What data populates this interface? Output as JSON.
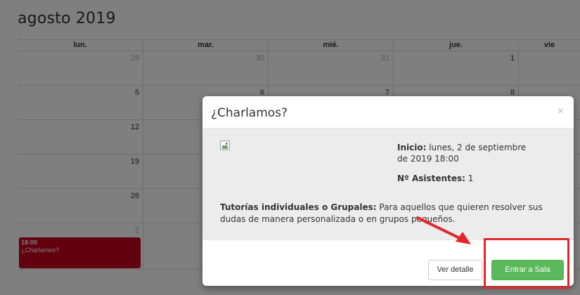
{
  "calendar": {
    "month_title": "agosto 2019",
    "weekdays": [
      "lun.",
      "mar.",
      "mié.",
      "jue.",
      "vie"
    ],
    "weeks": [
      [
        "29",
        "30",
        "31",
        "1",
        ""
      ],
      [
        "5",
        "6",
        "7",
        "8",
        ""
      ],
      [
        "12",
        "",
        "",
        "",
        ""
      ],
      [
        "19",
        "",
        "",
        "",
        ""
      ],
      [
        "26",
        "",
        "",
        "",
        ""
      ],
      [
        "2",
        "",
        "",
        "",
        ""
      ]
    ],
    "event": {
      "time": "18:00",
      "title": "¿Charlamos?",
      "color": "#c4001a"
    }
  },
  "modal": {
    "title": "¿Charlamos?",
    "close_glyph": "×",
    "start_label": "Inicio:",
    "start_value": " lunes, 2 de septiembre de 2019 18:00",
    "attendees_label": "Nº Asistentes:",
    "attendees_value": " 1",
    "desc_label": "Tutorías individuales o Grupales:",
    "desc_text": " Para aquellos que quieren resolver sus dudas de manera personalizada o en grupos pequeños.",
    "detail_button": "Ver detalle",
    "enter_button": "Entrar a Sala",
    "accent": "#5cb85c",
    "annotation_color": "#e3272b"
  }
}
